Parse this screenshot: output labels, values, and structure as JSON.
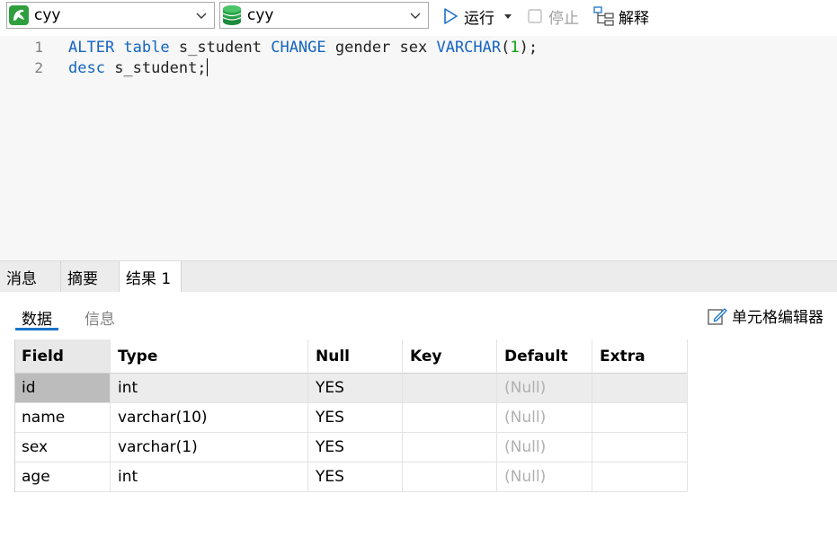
{
  "toolbar": {
    "connection": {
      "value": "cyy",
      "icon": "mysql-dolphin-icon",
      "color": "#2f9f3e"
    },
    "database": {
      "value": "cyy",
      "icon": "database-cylinder-icon",
      "color": "#2aa34a"
    },
    "run_label": "运行",
    "stop_label": "停止",
    "explain_label": "解释",
    "accent": "#1a73c8"
  },
  "editor": {
    "line_numbers": [
      "1",
      "2"
    ],
    "lines": [
      [
        {
          "t": "ALTER",
          "c": "kw"
        },
        {
          "t": " "
        },
        {
          "t": "table",
          "c": "kw"
        },
        {
          "t": " s_student "
        },
        {
          "t": "CHANGE",
          "c": "kw"
        },
        {
          "t": " gender sex "
        },
        {
          "t": "VARCHAR",
          "c": "kw"
        },
        {
          "t": "("
        },
        {
          "t": "1",
          "c": "num"
        },
        {
          "t": ");"
        }
      ],
      [
        {
          "t": "desc",
          "c": "kw"
        },
        {
          "t": " s_student;"
        }
      ]
    ]
  },
  "result_tabs": {
    "messages": "消息",
    "summary": "摘要",
    "result": "结果 1"
  },
  "subtabs": {
    "data": "数据",
    "info": "信息",
    "cell_editor": "单元格编辑器"
  },
  "grid": {
    "columns": [
      "Field",
      "Type",
      "Null",
      "Key",
      "Default",
      "Extra"
    ],
    "rows": [
      [
        "id",
        "int",
        "YES",
        "",
        "(Null)",
        ""
      ],
      [
        "name",
        "varchar(10)",
        "YES",
        "",
        "(Null)",
        ""
      ],
      [
        "sex",
        "varchar(1)",
        "YES",
        "",
        "(Null)",
        ""
      ],
      [
        "age",
        "int",
        "YES",
        "",
        "(Null)",
        ""
      ]
    ],
    "selected_row": 0
  }
}
